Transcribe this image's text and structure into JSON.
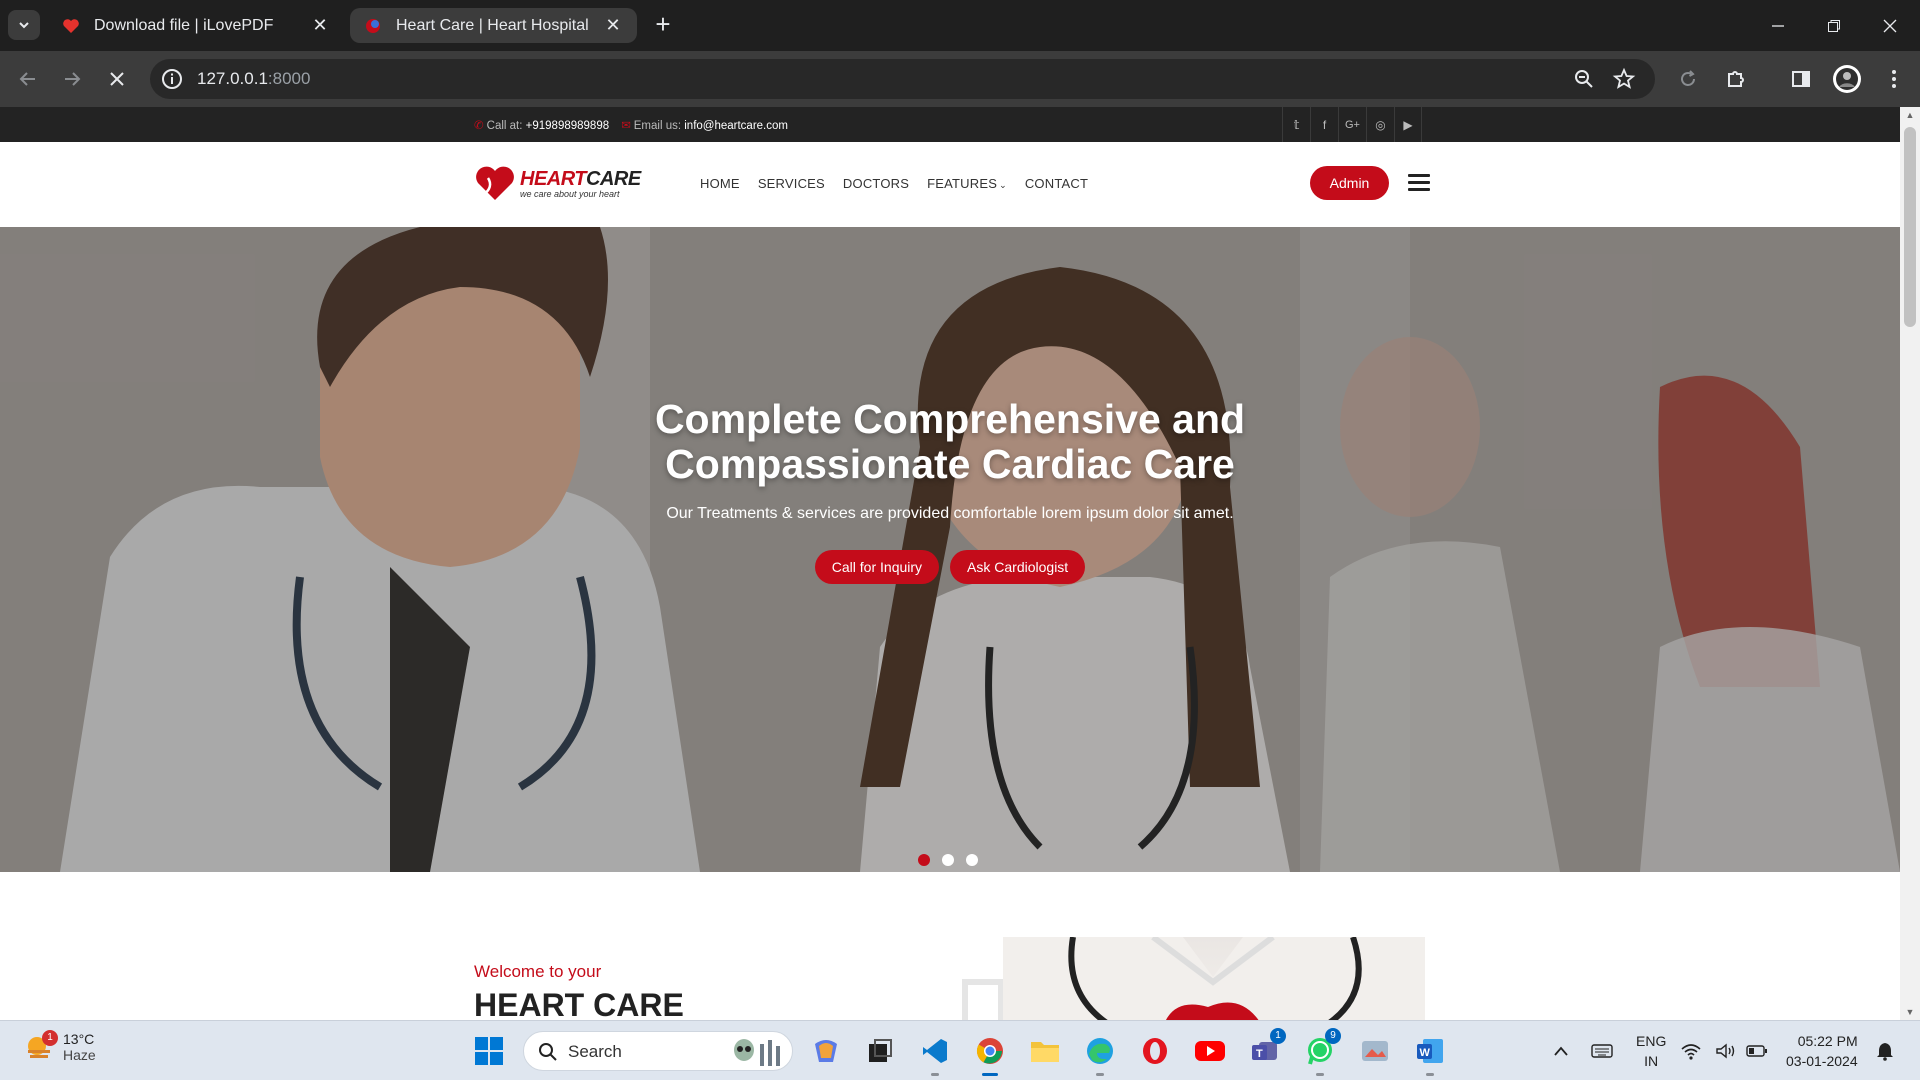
{
  "browser": {
    "tabs": [
      {
        "title": "Download file | iLovePDF",
        "active": false
      },
      {
        "title": "Heart Care | Heart Hospital",
        "active": true
      }
    ],
    "url_host": "127.0.0.1",
    "url_port": ":8000"
  },
  "topbar": {
    "call_label": "Call at:",
    "phone": "+919898989898",
    "email_label": "Email us:",
    "email": "info@heartcare.com",
    "social": [
      "twitter-icon",
      "facebook-icon",
      "google-plus-icon",
      "instagram-icon",
      "youtube-icon"
    ]
  },
  "nav": {
    "brand_red": "HEART",
    "brand_dark": "CARE",
    "tagline": "we care about your heart",
    "items": [
      "HOME",
      "SERVICES",
      "DOCTORS",
      "FEATURES",
      "CONTACT"
    ],
    "admin_label": "Admin"
  },
  "hero": {
    "title_line1": "Complete Comprehensive and",
    "title_line2": "Compassionate Cardiac Care",
    "subtitle": "Our Treatments & services are provided comfortable lorem ipsum dolor sit amet.",
    "cta_primary": "Call for Inquiry",
    "cta_secondary": "Ask Cardiologist",
    "slides": 3,
    "active_slide": 1
  },
  "about": {
    "kicker": "Welcome to your",
    "heading": "HEART CARE"
  },
  "taskbar": {
    "weather_temp": "13°C",
    "weather_cond": "Haze",
    "weather_badge": "1",
    "search_placeholder": "Search",
    "teams_badge": "1",
    "whatsapp_badge": "9",
    "lang_line1": "ENG",
    "lang_line2": "IN",
    "time": "05:22 PM",
    "date": "03-01-2024"
  },
  "colors": {
    "brand_red": "#c40c1a",
    "topbar_bg": "#232323",
    "chrome_bg": "#1f1f1f"
  }
}
